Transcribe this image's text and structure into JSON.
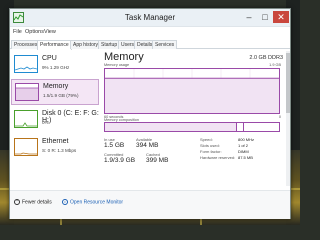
{
  "window": {
    "title": "Task Manager",
    "controls": {
      "minimize": "–",
      "maximize": "□",
      "close": "✕"
    }
  },
  "menu": [
    "File",
    "Options",
    "View"
  ],
  "tabs": [
    "Processes",
    "Performance",
    "App history",
    "Startup",
    "Users",
    "Details",
    "Services"
  ],
  "active_tab": "Performance",
  "resources": [
    {
      "name": "CPU",
      "detail": "9% 1.29 GHz",
      "color": "#1f8bd1",
      "selected": false
    },
    {
      "name": "Memory",
      "detail": "1.5/1.9 GB (79%)",
      "color": "#9a4aa8",
      "selected": true
    },
    {
      "name": "Disk 0 (C: E: F: G: H:)",
      "detail": "0%",
      "color": "#4aa02c",
      "selected": false
    },
    {
      "name": "Ethernet",
      "detail": "S: 0 R: 1.3 Mbps",
      "color": "#b8741a",
      "selected": false
    }
  ],
  "memory": {
    "heading": "Memory",
    "model": "2.0 GB DDR3",
    "usage_label": "Memory usage",
    "usage_max": "1.9 GB",
    "time_left": "60 seconds",
    "time_right": "0",
    "composition_label": "Memory composition",
    "usage_fraction": 0.79,
    "stats": [
      {
        "label": "In use",
        "value": "1.5 GB"
      },
      {
        "label": "Available",
        "value": "394 MB"
      },
      {
        "label": "Committed",
        "value": "1.9/3.9 GB"
      },
      {
        "label": "Cached",
        "value": "399 MB"
      }
    ],
    "details": [
      {
        "label": "Speed:",
        "value": "800 MHz"
      },
      {
        "label": "Slots used:",
        "value": "1 of 2"
      },
      {
        "label": "Form factor:",
        "value": "DIMM"
      },
      {
        "label": "Hardware reserved:",
        "value": "87.5 MB"
      }
    ]
  },
  "footer": {
    "fewer_details": "Fewer details",
    "open_resource_monitor": "Open Resource Monitor"
  }
}
